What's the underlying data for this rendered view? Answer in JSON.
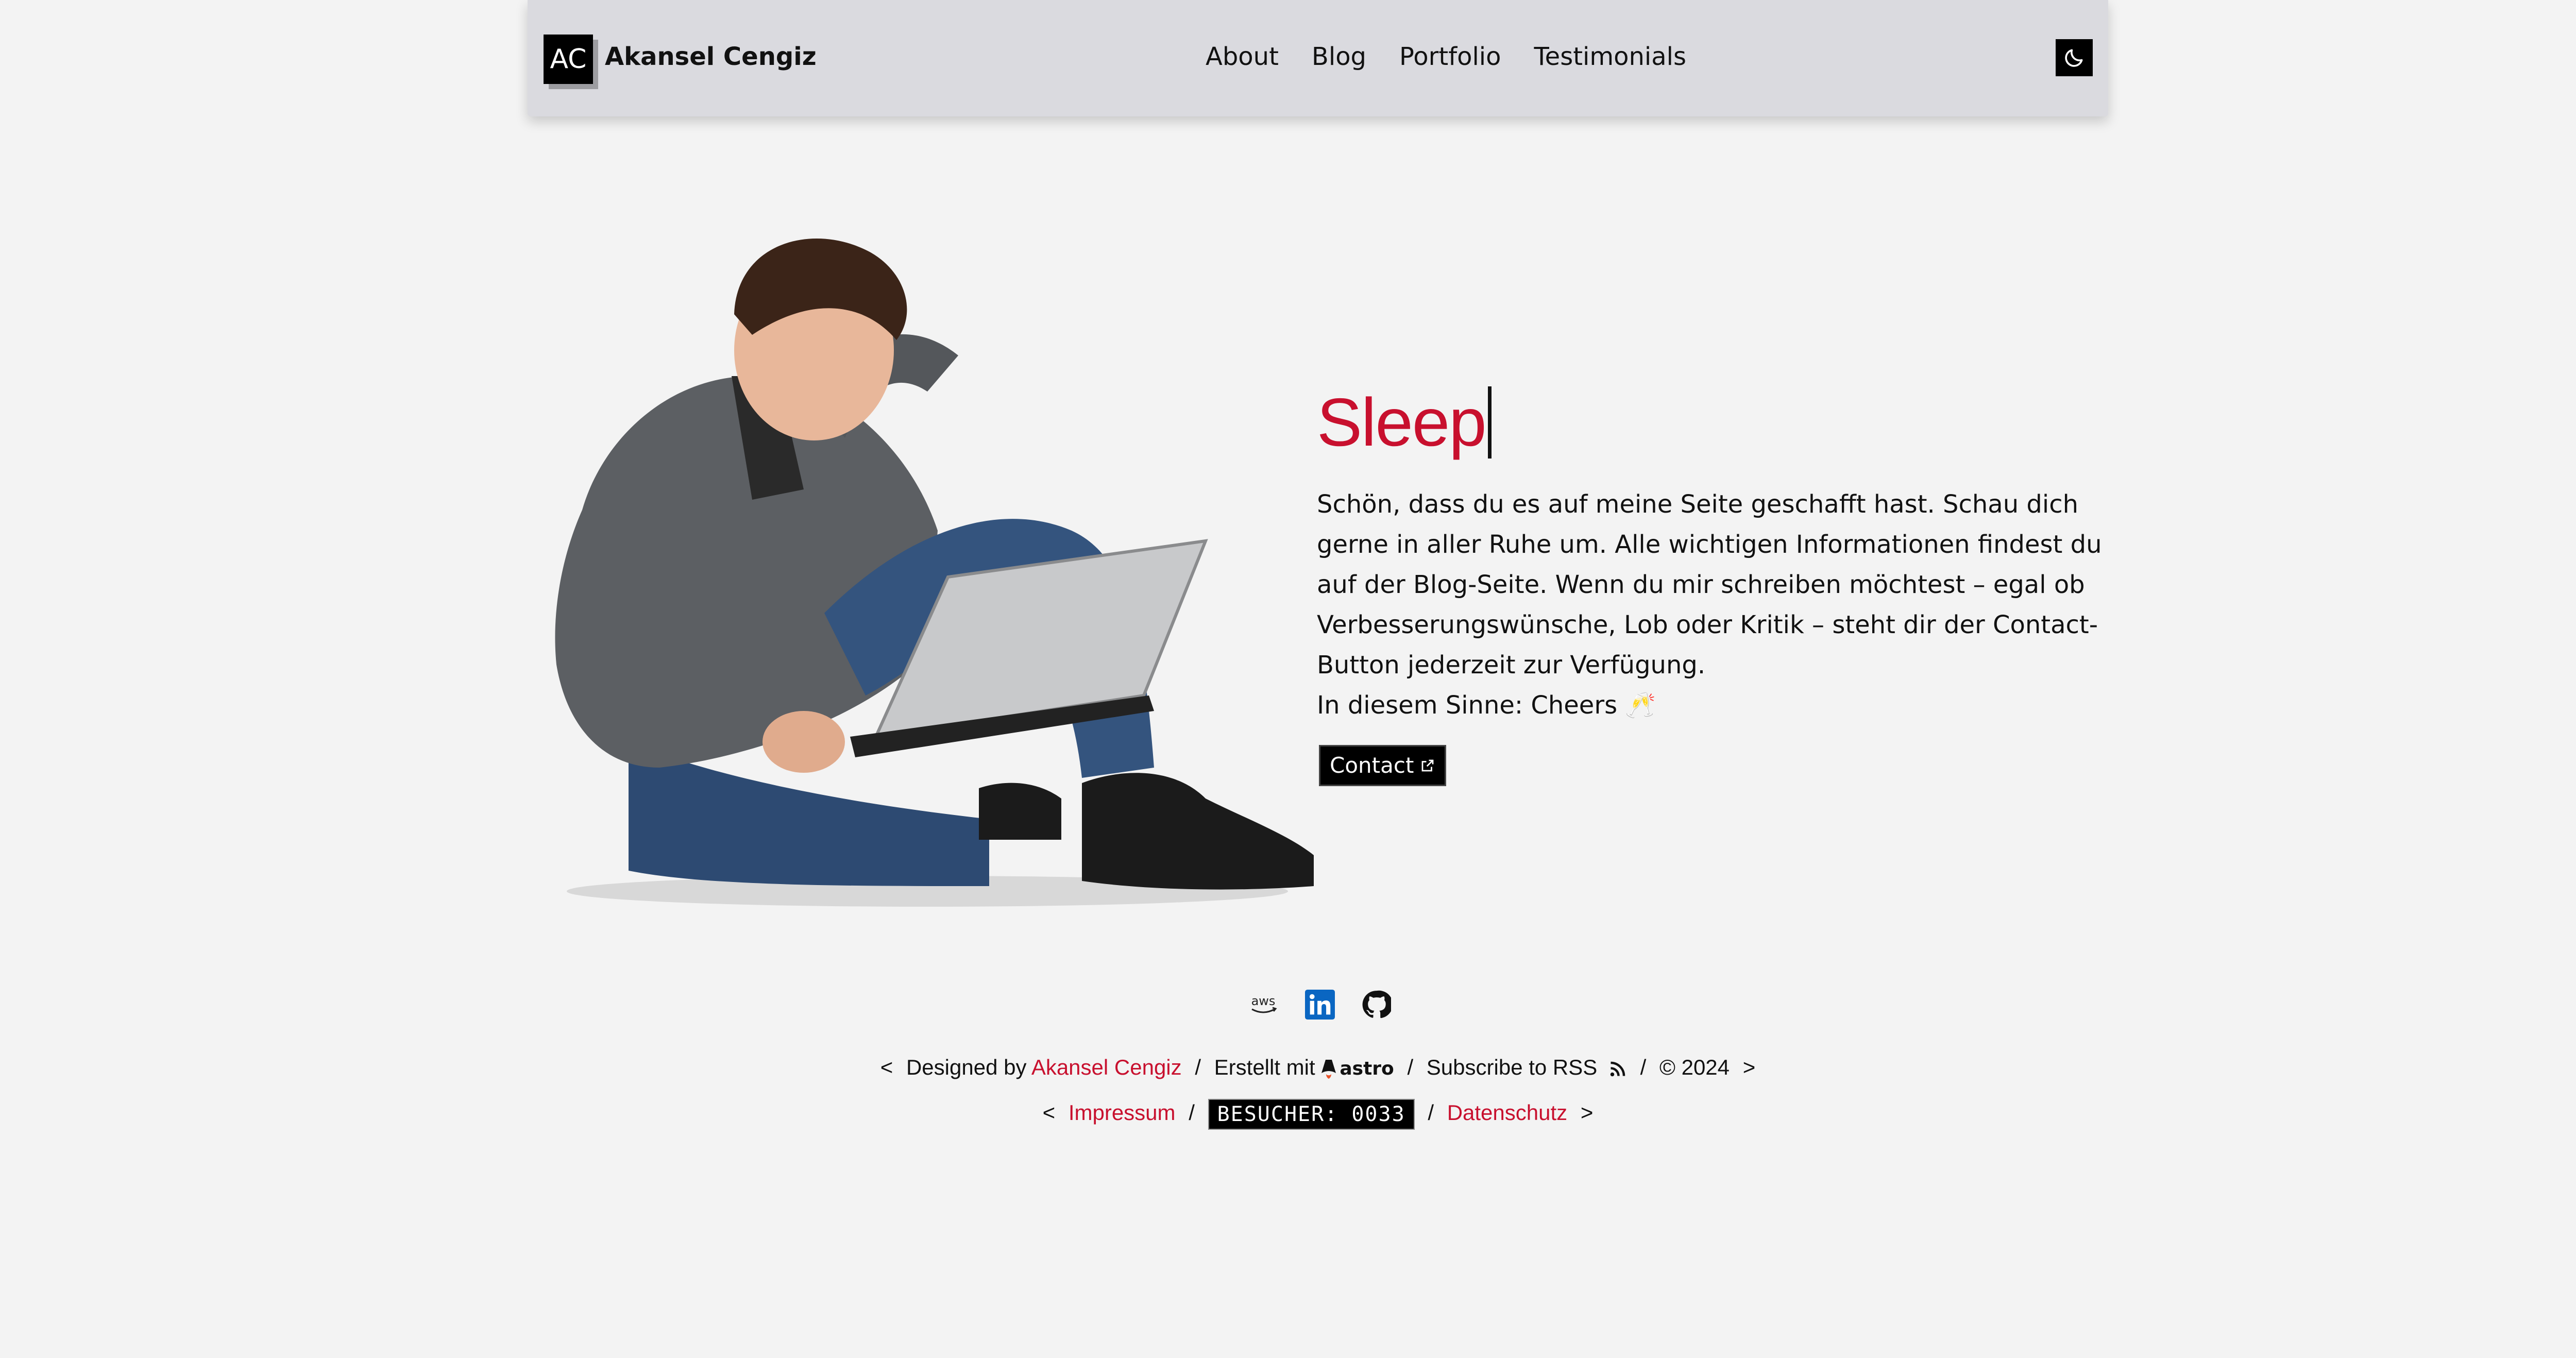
{
  "header": {
    "logo_text": "AC",
    "site_name": "Akansel Cengiz",
    "nav": [
      {
        "label": "About"
      },
      {
        "label": "Blog"
      },
      {
        "label": "Portfolio"
      },
      {
        "label": "Testimonials"
      }
    ],
    "theme_toggle_icon": "moon-icon"
  },
  "hero": {
    "title": "Sleep",
    "paragraph": "Schön, dass du es auf meine Seite geschafft hast. Schau dich gerne in aller Ruhe um. Alle wichtigen Informationen findest du auf der Blog-Seite. Wenn du mir schreiben möchtest – egal ob Verbesserungswünsche, Lob oder Kritik – steht dir der Contact-Button jederzeit zur Verfügung.",
    "closing": "In diesem Sinne: Cheers 🥂",
    "contact_label": "Contact",
    "contact_icon": "external-link-icon",
    "image_icon": "man-with-laptop-illustration"
  },
  "social": [
    {
      "icon": "aws-icon"
    },
    {
      "icon": "linkedin-icon"
    },
    {
      "icon": "github-icon"
    }
  ],
  "footer": {
    "open_bracket": "<",
    "close_bracket": ">",
    "designed_by": "Designed by",
    "designer_name": "Akansel Cengiz",
    "sep": "/",
    "built_with": "Erstellt mit",
    "astro_label": "astro",
    "subscribe": "Subscribe to RSS",
    "copyright": "© 2024",
    "impressum": "Impressum",
    "visitor_counter": "BESUCHER: 0033",
    "datenschutz": "Datenschutz"
  },
  "colors": {
    "accent": "#c8102e",
    "background": "#f3f3f3",
    "header_bg": "#dadadf"
  }
}
